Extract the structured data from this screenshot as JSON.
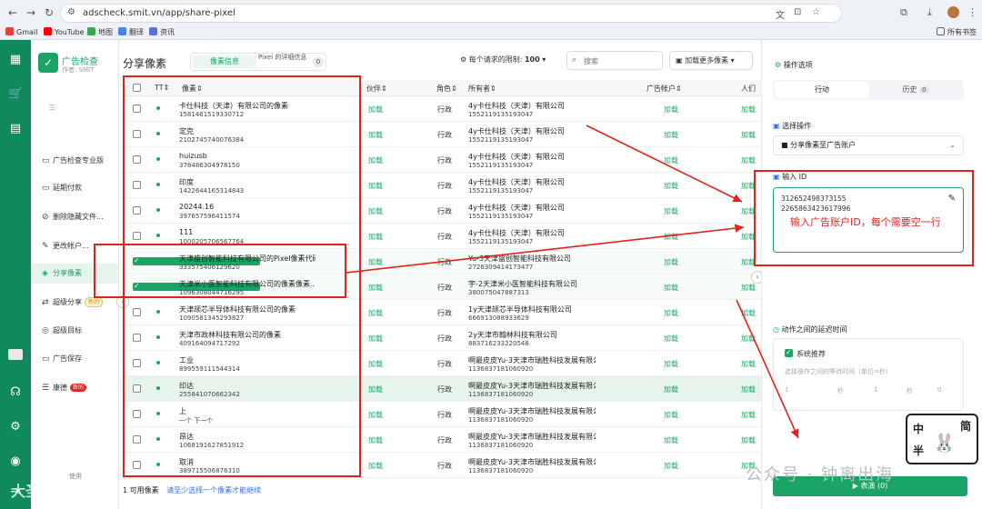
{
  "browser": {
    "url": "adscheck.smit.vn/app/share-pixel"
  },
  "bookmarks": {
    "gmail": "Gmail",
    "youtube": "YouTube",
    "maps": "地图",
    "translate": "翻译",
    "news": "资讯",
    "all": "所有书签"
  },
  "brand": {
    "title": "广告检查",
    "subtitle": "作者: SMIT"
  },
  "sidebar": {
    "collapse": "三\n菜单",
    "items": [
      {
        "label": "广告检查专业版"
      },
      {
        "label": "延期付款"
      },
      {
        "label": "删除隐藏文件..."
      },
      {
        "label": "更改帐户..."
      },
      {
        "label": "分享像素"
      },
      {
        "label": "超级分享",
        "badge": "新的"
      },
      {
        "label": "超级目标"
      },
      {
        "label": "广告保存"
      },
      {
        "label": "康德",
        "badge": "新的"
      }
    ],
    "footer": "使用"
  },
  "main": {
    "title": "分享像素",
    "tab1": "像素信息",
    "tab2": "Pixel 的详细信息",
    "tab_count": "0",
    "limit_label": "每个请求的限制:",
    "limit_value": "100",
    "search_placeholder": "搜索",
    "load_more": "加载更多像素",
    "headers": {
      "tt": "TT",
      "pixel": "像素",
      "partner": "伙伴",
      "role": "角色",
      "owner": "所有者",
      "ad_account": "广告帐户",
      "people": "人们"
    },
    "rows": [
      {
        "name": "卡仕科技（天津）有限公司的像素",
        "id": "1581461519330712",
        "p1": "加载",
        "role": "行政",
        "owner": "4y卡仕科技（天津）有限公司",
        "oid": "1552119135193047",
        "p2": "加载",
        "p3": "加载"
      },
      {
        "name": "定克",
        "id": "2102745740076384",
        "p1": "加载",
        "role": "行政",
        "owner": "4y卡仕科技（天津）有限公司",
        "oid": "1552119135193047",
        "p2": "加载",
        "p3": "加载"
      },
      {
        "name": "huizusb",
        "id": "378486304978150",
        "p1": "加载",
        "role": "行政",
        "owner": "4y卡仕科技（天津）有限公司",
        "oid": "1552119135193047",
        "p2": "加载",
        "p3": "加载"
      },
      {
        "name": "印度",
        "id": "1422644165314843",
        "p1": "加载",
        "role": "行政",
        "owner": "4y卡仕科技（天津）有限公司",
        "oid": "1552119135193047",
        "p2": "加载",
        "p3": "加载"
      },
      {
        "name": "20244.16",
        "id": "397657596411574",
        "p1": "加载",
        "role": "行政",
        "owner": "4y卡仕科技（天津）有限公司",
        "oid": "1552119135193047",
        "p2": "加载",
        "p3": "加载"
      },
      {
        "name": "111",
        "id": "1000205706567764",
        "p1": "加载",
        "role": "行政",
        "owner": "4y卡仕科技（天津）有限公司",
        "oid": "1552119135193047",
        "p2": "加载",
        "p3": "加载"
      },
      {
        "name": "天津盛创智能科技有限公司的Pixel像素代码",
        "id": "333575406129620",
        "p1": "加载",
        "role": "行政",
        "owner": "Yu-3天津盛创智能科技有限公司",
        "oid": "2726309414173477",
        "p2": "加载",
        "p3": "加载",
        "checked": true
      },
      {
        "name": "天津米小医智能科技有限公司的像素像素...",
        "id": "1096308044716295",
        "p1": "加载",
        "role": "行政",
        "owner": "宇-2天津米小医智能科技有限公司",
        "oid": "380075047887313",
        "p2": "加载",
        "p3": "加载",
        "checked": true
      },
      {
        "name": "天津颉芯半导体科技有限公司的像素",
        "id": "1090581345293827",
        "p1": "加载",
        "role": "行政",
        "owner": "1y天津颉芯半导体科技有限公司",
        "oid": "666913088933629",
        "p2": "加载",
        "p3": "加载"
      },
      {
        "name": "天津市政林科技有限公司的像素",
        "id": "409164094717292",
        "p1": "加载",
        "role": "行政",
        "owner": "2y天津市翰林科技有限公司",
        "oid": "883716233220548",
        "p2": "加载",
        "p3": "加载"
      },
      {
        "name": "工业",
        "id": "899559111544314",
        "p1": "加载",
        "role": "行政",
        "owner": "啊最皮皮Yu-3天津市瑞胜科技发展有限公...",
        "oid": "1136837181060920",
        "p2": "加载",
        "p3": "加载"
      },
      {
        "name": "印达",
        "id": "255841070662342",
        "p1": "加载",
        "role": "行政",
        "owner": "啊最皮皮Yu-3天津市瑞胜科技发展有限公...",
        "oid": "1136837181060920",
        "p2": "加载",
        "p3": "加载"
      },
      {
        "name": "上",
        "id": "一个 下一个",
        "p1": "加载",
        "role": "行政",
        "owner": "啊最皮皮Yu-3天津市瑞胜科技发展有限公...",
        "oid": "1136837181060920",
        "p2": "加载",
        "p3": "加载"
      },
      {
        "name": "昂达",
        "id": "1068191627851912",
        "p1": "加载",
        "role": "行政",
        "owner": "啊最皮皮Yu-3天津市瑞胜科技发展有限公...",
        "oid": "1136837181060920",
        "p2": "加载",
        "p3": "加载"
      },
      {
        "name": "取消",
        "id": "389715506876310",
        "p1": "加载",
        "role": "行政",
        "owner": "啊最皮皮Yu-3天津市瑞胜科技发展有限公...",
        "oid": "1136837181060920",
        "p2": "加载",
        "p3": "加载"
      }
    ],
    "footer_count": "1 可用像素",
    "footer_hint": "请至少选择一个像素才能继续"
  },
  "panel": {
    "title": "操作选项",
    "tab_action": "行动",
    "tab_history": "历史",
    "history_count": "0",
    "select_action_label": "选择操作",
    "action_value": "分享像素至广告账户",
    "input_id_label": "输入 ID",
    "ids": "312652498373155\n2265863423617996",
    "hint": "输入广告账户ID，每个需要空一行",
    "delay_label": "动作之间的延迟时间",
    "system_rec": "系统推荐",
    "delay_sub": "选择操作之间的等待时间（单位=秒）",
    "ticks": [
      "1",
      "秒",
      "1",
      "秒",
      "0"
    ],
    "submit": "表演 (0)"
  },
  "watermark": {
    "text": "公众号 · 钟离出海",
    "corner": "大圣跨境"
  },
  "sticker": {
    "a": "中",
    "b": "简",
    "c": "半"
  },
  "colors": {
    "brand": "#108a5c",
    "accent": "#1aa566",
    "annotation": "#e2231a"
  }
}
